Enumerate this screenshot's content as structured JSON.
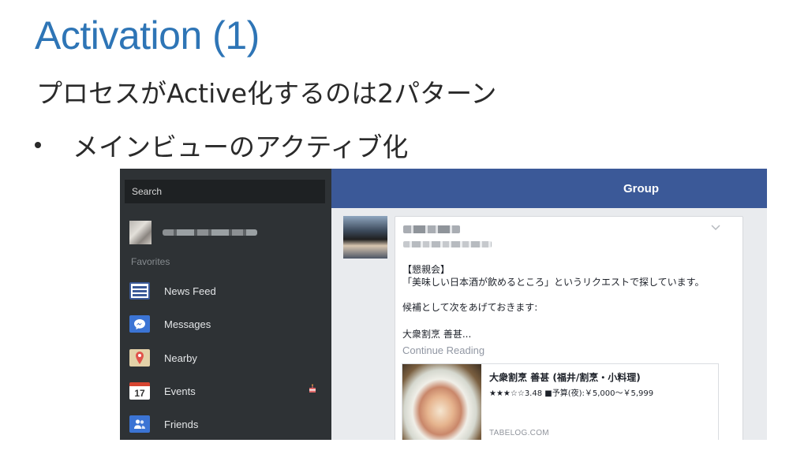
{
  "slide": {
    "title": "Activation (1)",
    "subtitle": "プロセスがActive化するのは2パターン",
    "bullet": "メインビューのアクティブ化"
  },
  "app": {
    "search_placeholder": "Search",
    "header_title": "Group",
    "favorites_label": "Favorites",
    "nav": [
      {
        "label": "News Feed",
        "icon": "news-feed-icon"
      },
      {
        "label": "Messages",
        "icon": "messages-icon"
      },
      {
        "label": "Nearby",
        "icon": "nearby-icon"
      },
      {
        "label": "Events",
        "icon": "events-icon",
        "icon_text": "17",
        "badge_icon": "birthday-cake-icon"
      },
      {
        "label": "Friends",
        "icon": "friends-icon"
      }
    ],
    "post": {
      "lines": [
        "【懇親会】",
        "「美味しい日本酒が飲めるところ」というリクエストで探しています。",
        "候補として次をあげておきます:",
        "大衆割烹 善甚..."
      ],
      "continue_label": "Continue Reading",
      "link": {
        "title": "大衆割烹 善甚 (福井/割烹・小料理)",
        "description": "★★★☆☆3.48 ■予算(夜):￥5,000～￥5,999",
        "domain": "TABELOG.COM"
      }
    }
  },
  "colors": {
    "title_blue": "#2e75b6",
    "facebook_blue": "#3b5998",
    "sidebar_dark": "#2e3235"
  }
}
